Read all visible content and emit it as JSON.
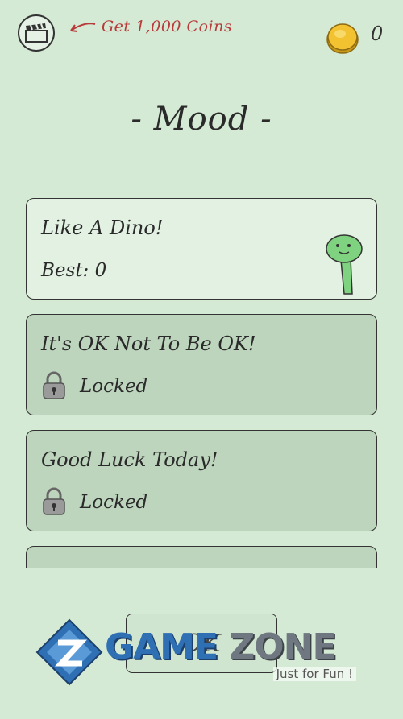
{
  "header": {
    "reward_text": "Get 1,000 Coins",
    "coin_count": "0"
  },
  "title": "- Mood -",
  "modes": [
    {
      "title": "Like A Dino!",
      "status": "Best: 0",
      "locked": false
    },
    {
      "title": "It's OK Not To Be OK!",
      "status": "Locked",
      "locked": true
    },
    {
      "title": "Good Luck Today!",
      "status": "Locked",
      "locked": true
    }
  ],
  "ok_button": {
    "label": "OK"
  },
  "watermark": {
    "brand_a": "GAME",
    "brand_b": "ZONE",
    "tagline": "Just for Fun !"
  },
  "colors": {
    "background": "#d4ead4",
    "card_unlocked": "#e3f1e3",
    "card_locked": "#bdd4bd",
    "reward_text": "#b83a3a",
    "coin": "#f2c230",
    "dino": "#7fd27f"
  },
  "icons": [
    "clapperboard-icon",
    "arrow-icon",
    "coin-icon",
    "lock-icon",
    "dino-icon"
  ]
}
